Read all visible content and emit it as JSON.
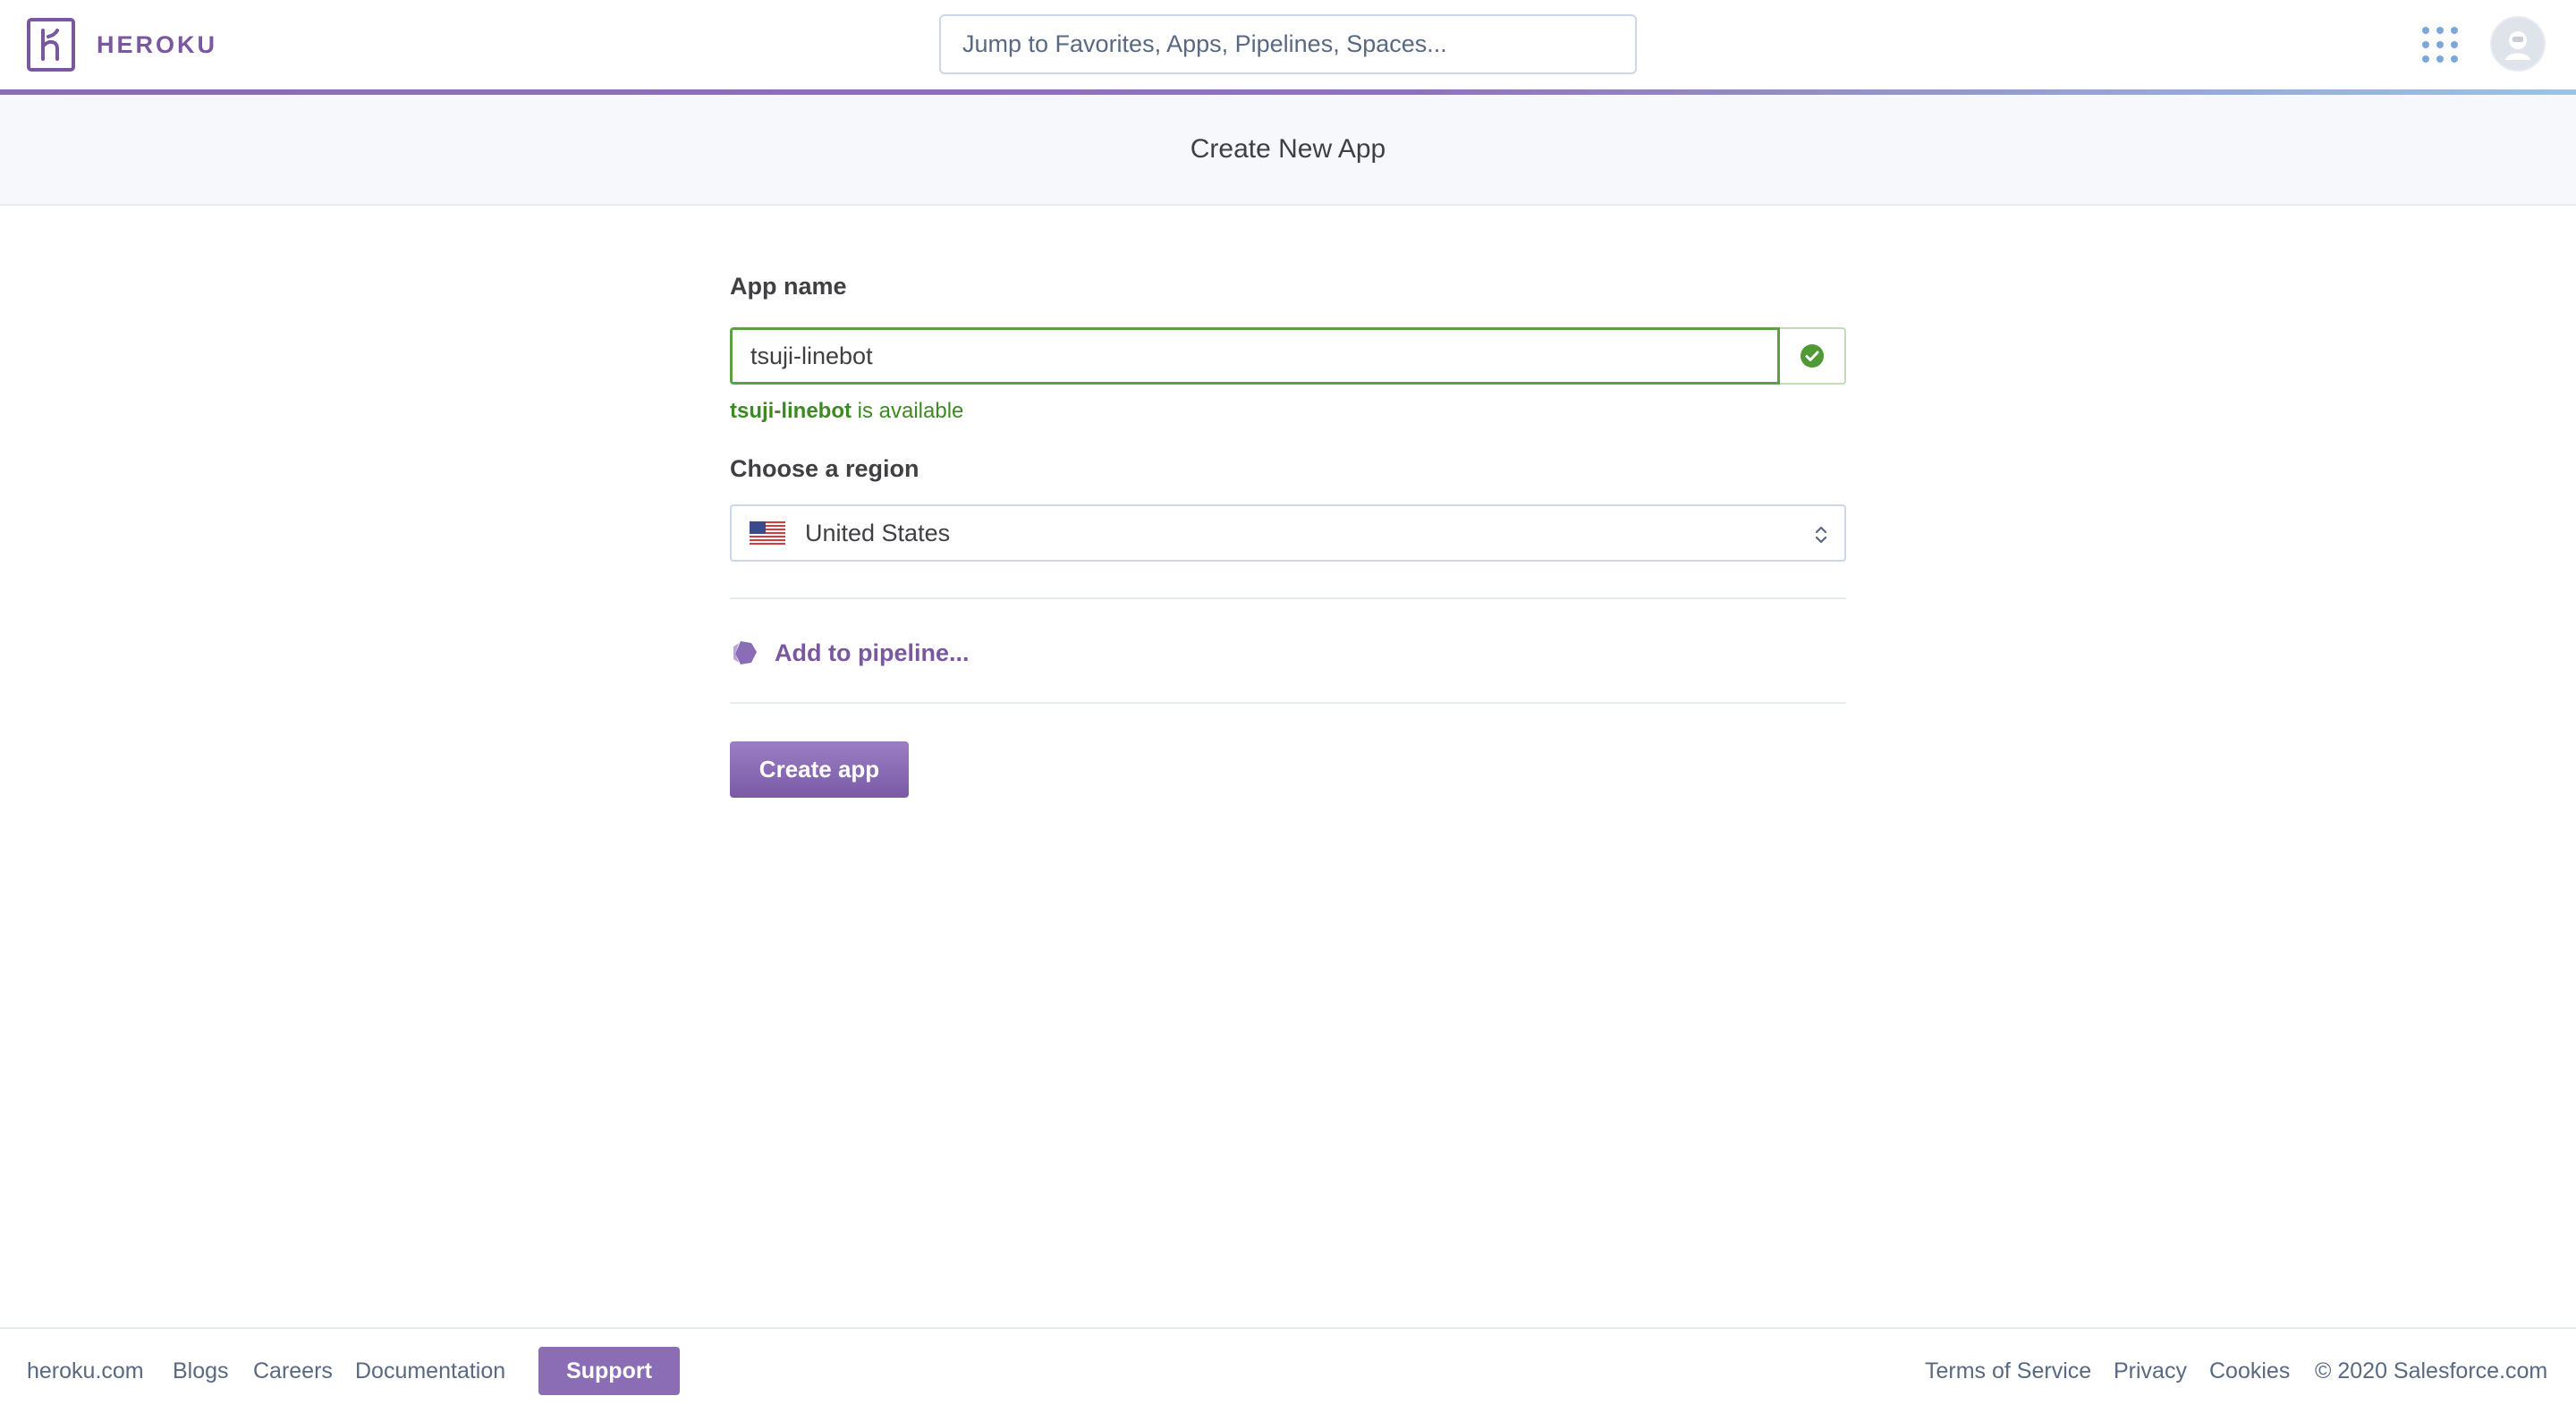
{
  "header": {
    "brand": "HEROKU",
    "search_placeholder": "Jump to Favorites, Apps, Pipelines, Spaces...",
    "icons": [
      "heroku-logo-icon",
      "apps-grid-icon",
      "avatar-icon"
    ]
  },
  "page": {
    "title": "Create New App"
  },
  "form": {
    "app_name_label": "App name",
    "app_name_value": "tsuji-linebot",
    "availability_name": "tsuji-linebot",
    "availability_text": " is available",
    "region_label": "Choose a region",
    "region_value": "United States",
    "pipeline_label": "Add to pipeline...",
    "create_button": "Create app"
  },
  "footer": {
    "links_left": [
      "heroku.com",
      "Blogs",
      "Careers",
      "Documentation"
    ],
    "support_button": "Support",
    "links_right": [
      "Terms of Service",
      "Privacy",
      "Cookies"
    ],
    "copyright": "© 2020 Salesforce.com"
  },
  "colors": {
    "brand_purple": "#79589f",
    "success_green": "#3d8a24",
    "border_gray": "#cfd7e6",
    "subheader_bg": "#f7f8fb"
  }
}
